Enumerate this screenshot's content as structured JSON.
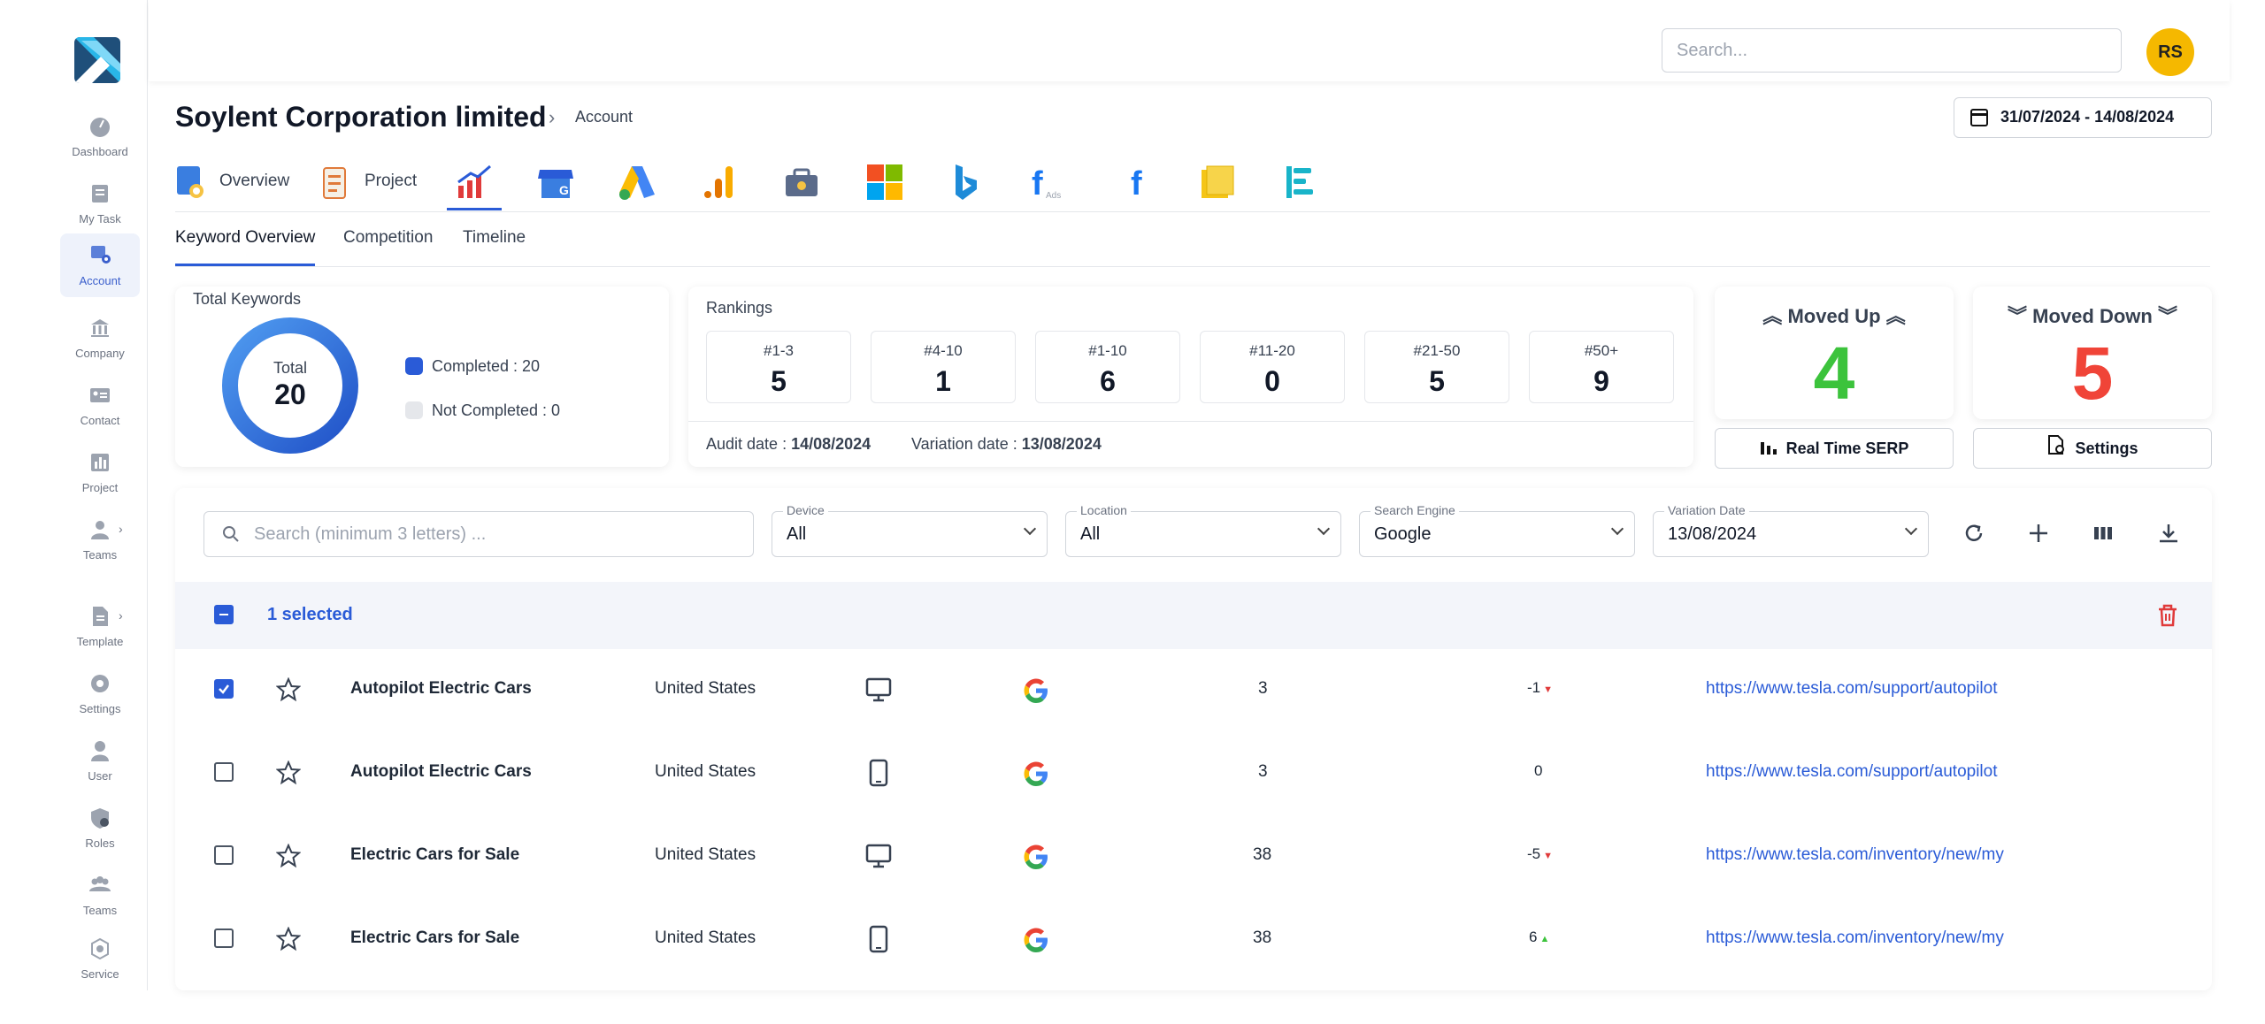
{
  "sidebar": {
    "items": [
      {
        "label": "Dashboard",
        "icon": "gauge-icon"
      },
      {
        "label": "My Task",
        "icon": "task-list-icon"
      },
      {
        "label": "Account",
        "icon": "account-icon"
      },
      {
        "label": "Company",
        "icon": "building-icon"
      },
      {
        "label": "Contact",
        "icon": "contact-card-icon"
      },
      {
        "label": "Project",
        "icon": "project-chart-icon"
      },
      {
        "label": "Teams",
        "icon": "teams-icon"
      },
      {
        "label": "Template",
        "icon": "template-icon"
      },
      {
        "label": "Settings",
        "icon": "gear-icon"
      },
      {
        "label": "User",
        "icon": "user-icon"
      },
      {
        "label": "Roles",
        "icon": "roles-shield-icon"
      },
      {
        "label": "Teams",
        "icon": "teams-group-icon"
      },
      {
        "label": "Service",
        "icon": "service-icon"
      }
    ],
    "active": "Account"
  },
  "topbar": {
    "search_placeholder": "Search...",
    "avatar_initials": "RS"
  },
  "header": {
    "title": "Soylent Corporation limited",
    "breadcrumb": "Account",
    "date_range": "31/07/2024 - 14/08/2024"
  },
  "icon_tabs": {
    "overview": "Overview",
    "project": "Project"
  },
  "subtabs": {
    "keyword_overview": "Keyword Overview",
    "competition": "Competition",
    "timeline": "Timeline"
  },
  "total_keywords": {
    "title": "Total Keywords",
    "total_label": "Total",
    "total_value": "20",
    "completed_label": "Completed : 20",
    "not_completed_label": "Not Completed : 0",
    "completed_color": "#2a5bd7"
  },
  "rankings": {
    "title": "Rankings",
    "buckets": [
      {
        "label": "#1-3",
        "value": "5"
      },
      {
        "label": "#4-10",
        "value": "1"
      },
      {
        "label": "#1-10",
        "value": "6"
      },
      {
        "label": "#11-20",
        "value": "0"
      },
      {
        "label": "#21-50",
        "value": "5"
      },
      {
        "label": "#50+",
        "value": "9"
      }
    ],
    "audit_label": "Audit date : ",
    "audit_date": "14/08/2024",
    "variation_label": "Variation date : ",
    "variation_date": "13/08/2024"
  },
  "moved_up": {
    "title": "Moved Up",
    "value": "4",
    "color": "#3cc33c"
  },
  "moved_down": {
    "title": "Moved Down",
    "value": "5",
    "color": "#f04438"
  },
  "actions": {
    "real_time_serp": "Real Time SERP",
    "settings": "Settings"
  },
  "filters": {
    "search_placeholder": "Search (minimum 3 letters) ...",
    "device": {
      "label": "Device",
      "value": "All"
    },
    "location": {
      "label": "Location",
      "value": "All"
    },
    "search_engine": {
      "label": "Search Engine",
      "value": "Google"
    },
    "variation_date": {
      "label": "Variation Date",
      "value": "13/08/2024"
    }
  },
  "selection": {
    "text": "1 selected"
  },
  "rows": [
    {
      "keyword": "Autopilot Electric Cars",
      "location": "United States",
      "device": "desktop",
      "rank": "3",
      "change": "-1",
      "change_dir": "down",
      "url": "https://www.tesla.com/support/autopilot",
      "checked": true
    },
    {
      "keyword": "Autopilot Electric Cars",
      "location": "United States",
      "device": "mobile",
      "rank": "3",
      "change": "0",
      "change_dir": "none",
      "url": "https://www.tesla.com/support/autopilot",
      "checked": false
    },
    {
      "keyword": "Electric Cars for Sale",
      "location": "United States",
      "device": "desktop",
      "rank": "38",
      "change": "-5",
      "change_dir": "down",
      "url": "https://www.tesla.com/inventory/new/my",
      "checked": false
    },
    {
      "keyword": "Electric Cars for Sale",
      "location": "United States",
      "device": "mobile",
      "rank": "38",
      "change": "6",
      "change_dir": "up",
      "url": "https://www.tesla.com/inventory/new/my",
      "checked": false
    }
  ]
}
